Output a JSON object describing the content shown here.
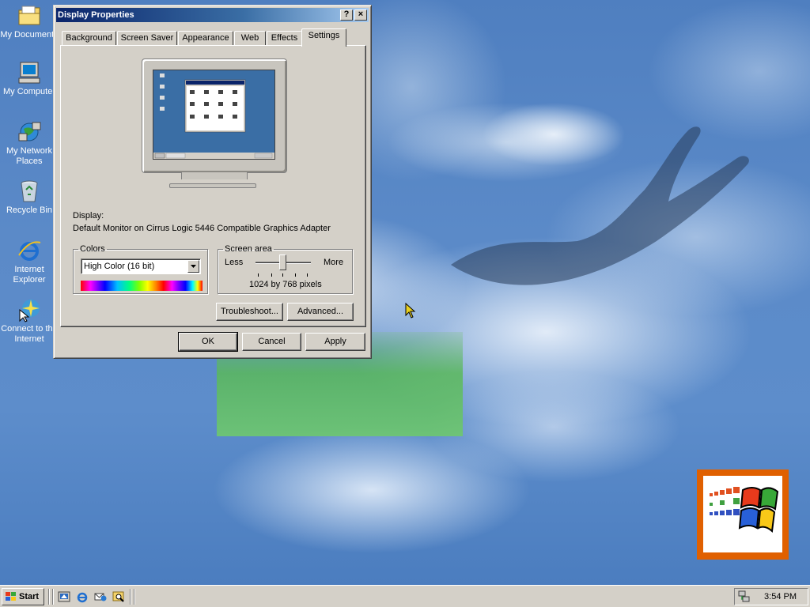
{
  "desktop": {
    "icons": [
      {
        "label": "My Documents",
        "icon": "my-documents-icon"
      },
      {
        "label": "My Computer",
        "icon": "my-computer-icon"
      },
      {
        "label": "My Network Places",
        "icon": "network-places-icon"
      },
      {
        "label": "Recycle Bin",
        "icon": "recycle-bin-icon"
      },
      {
        "label": "Internet Explorer",
        "icon": "internet-explorer-icon"
      },
      {
        "label": "Connect to the Internet",
        "icon": "connect-internet-icon"
      }
    ],
    "accent_color": "#3a6ea5"
  },
  "dialog": {
    "title": "Display Properties",
    "help_button": "?",
    "close_button": "×",
    "tabs": [
      {
        "label": "Background",
        "active": false
      },
      {
        "label": "Screen Saver",
        "active": false
      },
      {
        "label": "Appearance",
        "active": false
      },
      {
        "label": "Web",
        "active": false
      },
      {
        "label": "Effects",
        "active": false
      },
      {
        "label": "Settings",
        "active": true
      }
    ],
    "display_label": "Display:",
    "display_value": "Default Monitor on Cirrus Logic 5446 Compatible Graphics Adapter",
    "colors": {
      "legend": "Colors",
      "selected": "High Color (16 bit)"
    },
    "screen_area": {
      "legend": "Screen area",
      "less_label": "Less",
      "more_label": "More",
      "value_text": "1024 by 768 pixels"
    },
    "buttons": {
      "troubleshoot": "Troubleshoot...",
      "advanced": "Advanced...",
      "ok": "OK",
      "cancel": "Cancel",
      "apply": "Apply"
    }
  },
  "taskbar": {
    "start_label": "Start",
    "quick_launch": [
      "show-desktop-icon",
      "internet-explorer-icon",
      "outlook-express-icon",
      "search-icon"
    ],
    "tray_icon": "network-tray-icon",
    "clock": "3:54 PM"
  }
}
